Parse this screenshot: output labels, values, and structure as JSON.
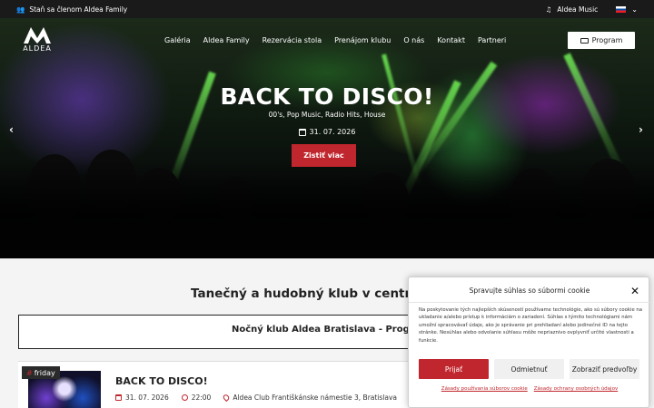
{
  "topbar": {
    "family_link": "Staň sa členom Aldea Family",
    "music_link": "Aldea Music"
  },
  "logo": {
    "text": "ALDEA"
  },
  "nav": {
    "items": [
      "Galéria",
      "Aldea Family",
      "Rezervácia stola",
      "Prenájom klubu",
      "O nás",
      "Kontakt",
      "Partneri"
    ],
    "program_button": "Program"
  },
  "hero": {
    "title": "BACK TO DISCO!",
    "subtitle": "00's, Pop Music, Radio Hits, House",
    "date": "31. 07. 2026",
    "cta": "Zistiť viac"
  },
  "content": {
    "section_title": "Tanečný a hudobný klub v centre B",
    "program_box_title": "Nočný klub Aldea Bratislava - Program"
  },
  "event": {
    "tag": "friday",
    "title": "BACK TO DISCO!",
    "date": "31. 07. 2026",
    "time": "22:00",
    "location": "Aldea Club Františkánske námestie 3, Bratislava"
  },
  "cookie": {
    "title": "Spravujte súhlas so súbormi cookie",
    "text": "Na poskytovanie tých najlepších skúseností používame technológie, ako sú súbory cookie na ukladanie a/alebo prístup k informáciám o zariadení. Súhlas s týmito technológiami nám umožní spracovávať údaje, ako je správanie pri prehliadaní alebo jedinečné ID na tejto stránke. Nesúhlas alebo odvolanie súhlasu môže nepriaznivo ovplyvniť určité vlastnosti a funkcie.",
    "accept": "Prijať",
    "deny": "Odmietnuť",
    "preferences": "Zobraziť predvoľby",
    "link_cookie_policy": "Zásady používania súborov cookie",
    "link_privacy": "Zásady ochrany osobných údajov"
  },
  "colors": {
    "accent": "#c0262d",
    "topbar": "#1a1a1a"
  },
  "icons": [
    "users-icon",
    "music-note-icon",
    "flag-sk-icon",
    "chevron-down-icon",
    "ticket-icon",
    "calendar-icon",
    "clock-icon",
    "map-pin-icon",
    "close-icon",
    "arrow-left-icon",
    "arrow-right-icon"
  ]
}
